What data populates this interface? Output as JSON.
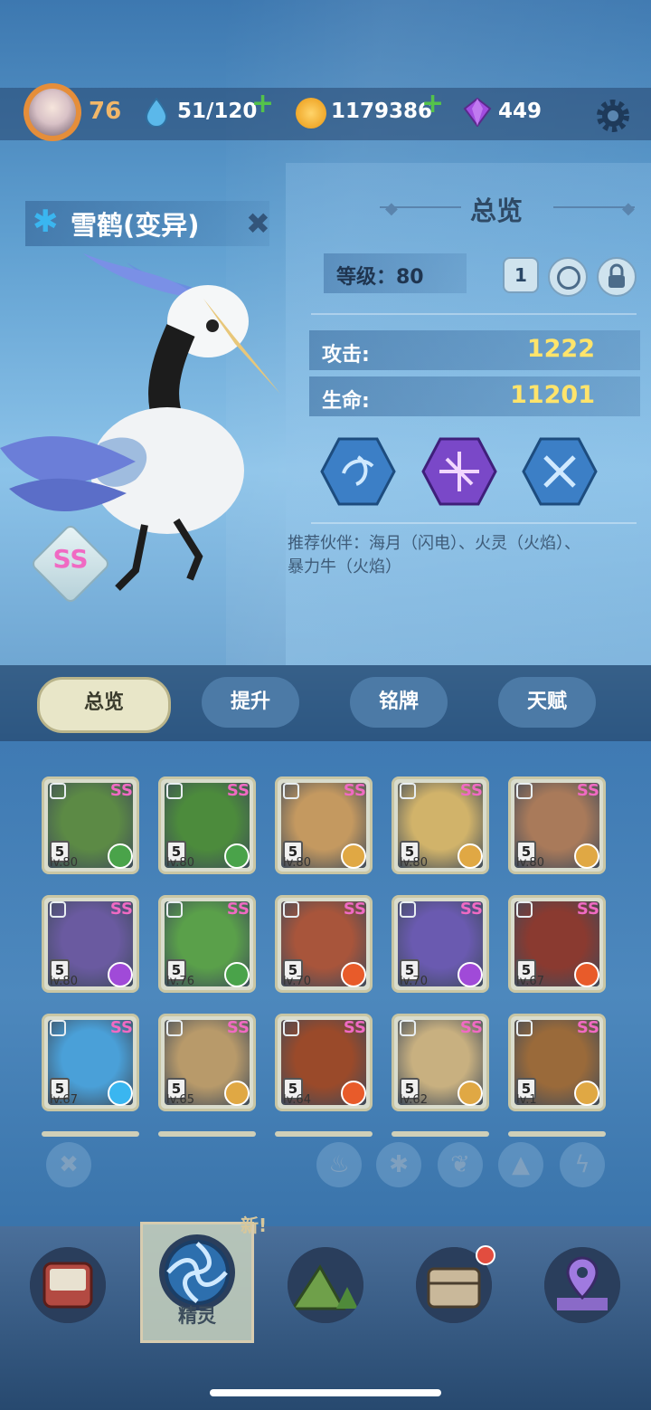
{
  "header": {
    "player_level": "76",
    "energy": "51/120",
    "coins": "1179386",
    "gems": "449"
  },
  "pet": {
    "name": "雪鹤(变异)",
    "rarity": "SS",
    "element_icon": "snowflake-icon"
  },
  "overview": {
    "title": "总览",
    "level_label": "等级：80",
    "star_button": "1",
    "attack_label": "攻击:",
    "attack_value": "1222",
    "hp_label": "生命:",
    "hp_value": "11201",
    "recommend": "推荐伙伴：海月（闪电）、火灵（火焰）、暴力牛（火焰）"
  },
  "tabs": [
    "总览",
    "提升",
    "铭牌",
    "天赋"
  ],
  "pets": [
    {
      "rarity": "SS",
      "stars": "5",
      "level": "lv.80",
      "element": "grass",
      "color": "#5c8a45"
    },
    {
      "rarity": "SS",
      "stars": "5",
      "level": "lv.80",
      "element": "grass",
      "color": "#4c8b3c"
    },
    {
      "rarity": "SS",
      "stars": "5",
      "level": "lv.80",
      "element": "rock",
      "color": "#c49960"
    },
    {
      "rarity": "SS",
      "stars": "5",
      "level": "lv.80",
      "element": "rock",
      "color": "#d1b36a"
    },
    {
      "rarity": "SS",
      "stars": "5",
      "level": "lv.80",
      "element": "rock",
      "color": "#a97a5a"
    },
    {
      "rarity": "SS",
      "stars": "5",
      "level": "lv.80",
      "element": "electric",
      "color": "#6a5aa0"
    },
    {
      "rarity": "SS",
      "stars": "5",
      "level": "lv.76",
      "element": "grass",
      "color": "#5aa04a"
    },
    {
      "rarity": "SS",
      "stars": "5",
      "level": "lv.70",
      "element": "fire",
      "color": "#a8553b"
    },
    {
      "rarity": "SS",
      "stars": "5",
      "level": "lv.70",
      "element": "electric",
      "color": "#6a5ab0"
    },
    {
      "rarity": "SS",
      "stars": "5",
      "level": "lv.67",
      "element": "fire",
      "color": "#8a3a30"
    },
    {
      "rarity": "SS",
      "stars": "5",
      "level": "lv.67",
      "element": "ice",
      "color": "#4aa0d8"
    },
    {
      "rarity": "SS",
      "stars": "5",
      "level": "lv.65",
      "element": "rock",
      "color": "#b89a6a"
    },
    {
      "rarity": "SS",
      "stars": "5",
      "level": "lv.64",
      "element": "fire",
      "color": "#9a4a2a"
    },
    {
      "rarity": "SS",
      "stars": "5",
      "level": "lv.62",
      "element": "rock",
      "color": "#c8b080"
    },
    {
      "rarity": "SS",
      "stars": "5",
      "level": "lv.1",
      "element": "rock",
      "color": "#9a6a3a"
    }
  ],
  "element_colors": {
    "grass": "#4aa34a",
    "rock": "#e0a844",
    "fire": "#e85b2a",
    "electric": "#a04ad8",
    "ice": "#3ab6f0"
  },
  "filters": [
    "close-icon",
    "fire-icon",
    "ice-icon",
    "grass-icon",
    "rock-icon",
    "electric-icon"
  ],
  "nav": {
    "items": [
      "book-icon",
      "pet-icon",
      "mountain-icon",
      "bag-icon",
      "map-pin-icon"
    ],
    "active_label": "精灵",
    "new_tag": "新!"
  }
}
